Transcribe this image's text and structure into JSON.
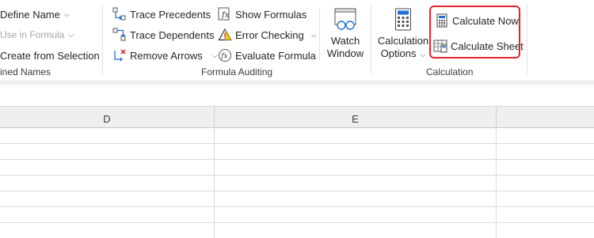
{
  "ribbon": {
    "defined_names": {
      "define_name": "Define Name",
      "use_in_formula": "Use in Formula",
      "create_from_selection": "Create from Selection",
      "group_label": "ined Names"
    },
    "formula_auditing": {
      "trace_precedents": "Trace Precedents",
      "trace_dependents": "Trace Dependents",
      "remove_arrows": "Remove Arrows",
      "show_formulas": "Show Formulas",
      "error_checking": "Error Checking",
      "evaluate_formula": "Evaluate Formula",
      "watch_window_line1": "Watch",
      "watch_window_line2": "Window",
      "group_label": "Formula Auditing"
    },
    "calculation": {
      "options_line1": "Calculation",
      "options_line2": "Options",
      "calculate_now": "Calculate Now",
      "calculate_sheet": "Calculate Sheet",
      "group_label": "Calculation"
    }
  },
  "sheet": {
    "columns": [
      "D",
      "E"
    ]
  },
  "colors": {
    "highlight": "#e3242b",
    "header_bg": "#efefef",
    "gridline": "#dadada"
  }
}
